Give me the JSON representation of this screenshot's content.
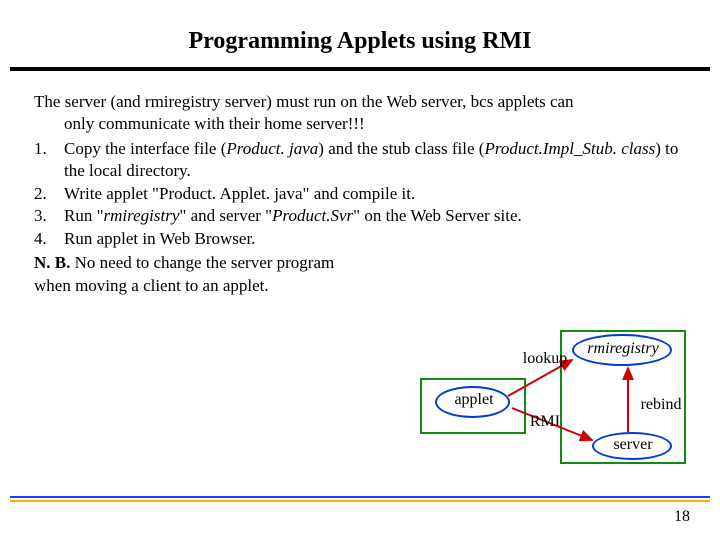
{
  "title": "Programming Applets using RMI",
  "intro_line1": "The server (and rmiregistry server) must run on the Web server, bcs applets can",
  "intro_line2": "only communicate with their home server!!!",
  "items": [
    {
      "num": "1.",
      "prefix": "Copy the interface file (",
      "ital1": "Product. java",
      "mid1": ") and the stub class file (",
      "ital2": "Product.Impl_Stub. class",
      "suffix": ") to the local directory."
    },
    {
      "num": "2.",
      "text": "Write applet \"Product. Applet. java\" and compile it."
    },
    {
      "num": "3.",
      "prefix": "Run \"",
      "ital1": "rmiregistry",
      "mid1": "\" and server \"",
      "ital2": "Product.Svr",
      "suffix": "\" on the Web Server site."
    },
    {
      "num": "4.",
      "text": "Run applet in Web Browser."
    }
  ],
  "nb_label": "N. B.",
  "nb_line1": " No need to change the server program",
  "nb_line2": "when moving a client to an applet.",
  "diagram": {
    "applet": "applet",
    "lookup": "lookup",
    "rmi": "RMI",
    "rmiregistry": "rmiregistry",
    "rebind": "rebind",
    "server": "server"
  },
  "page_number": "18"
}
